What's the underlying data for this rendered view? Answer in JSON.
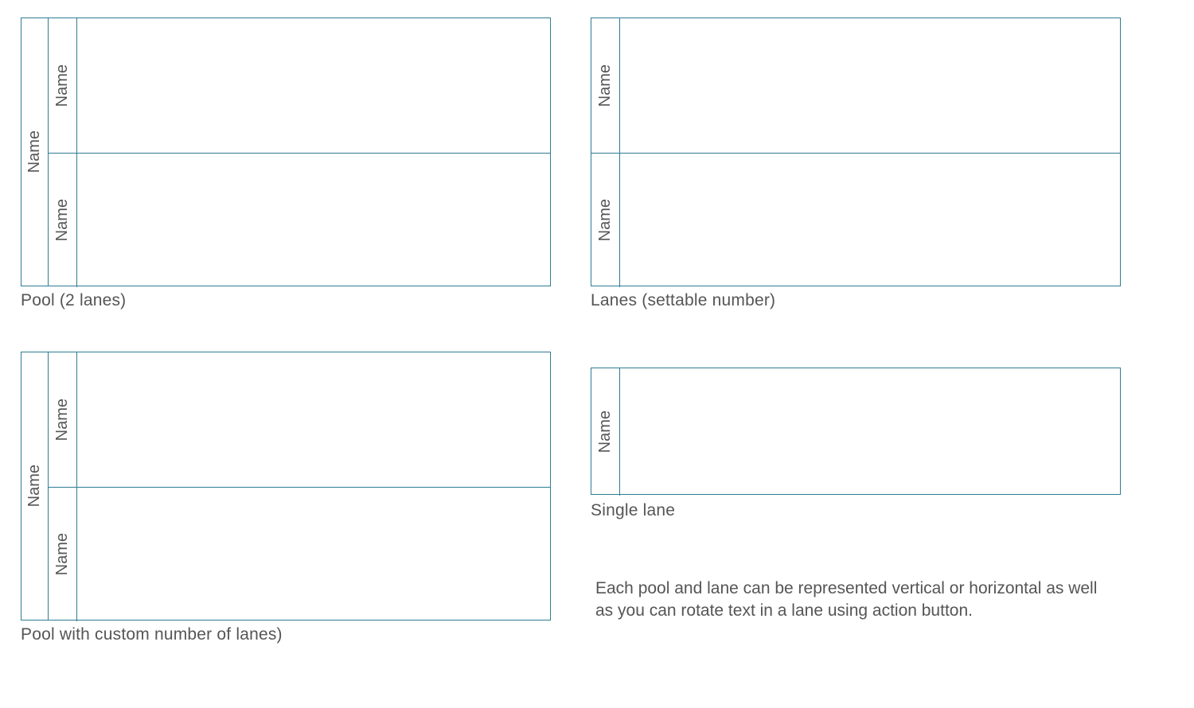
{
  "labels": {
    "name": "Name"
  },
  "shapes": {
    "pool2": {
      "caption": "Pool (2 lanes)",
      "pool_label": "Name",
      "lanes": [
        "Name",
        "Name"
      ]
    },
    "lanes_settable": {
      "caption": "Lanes (settable number)",
      "lanes": [
        "Name",
        "Name"
      ]
    },
    "pool_custom": {
      "caption": "Pool with custom number of lanes)",
      "pool_label": "Name",
      "lanes": [
        "Name",
        "Name"
      ]
    },
    "single_lane": {
      "caption": "Single lane",
      "lanes": [
        "Name"
      ]
    }
  },
  "note": "Each pool and lane can be represented vertical or horizontal as well as you can rotate text in a lane using action button."
}
